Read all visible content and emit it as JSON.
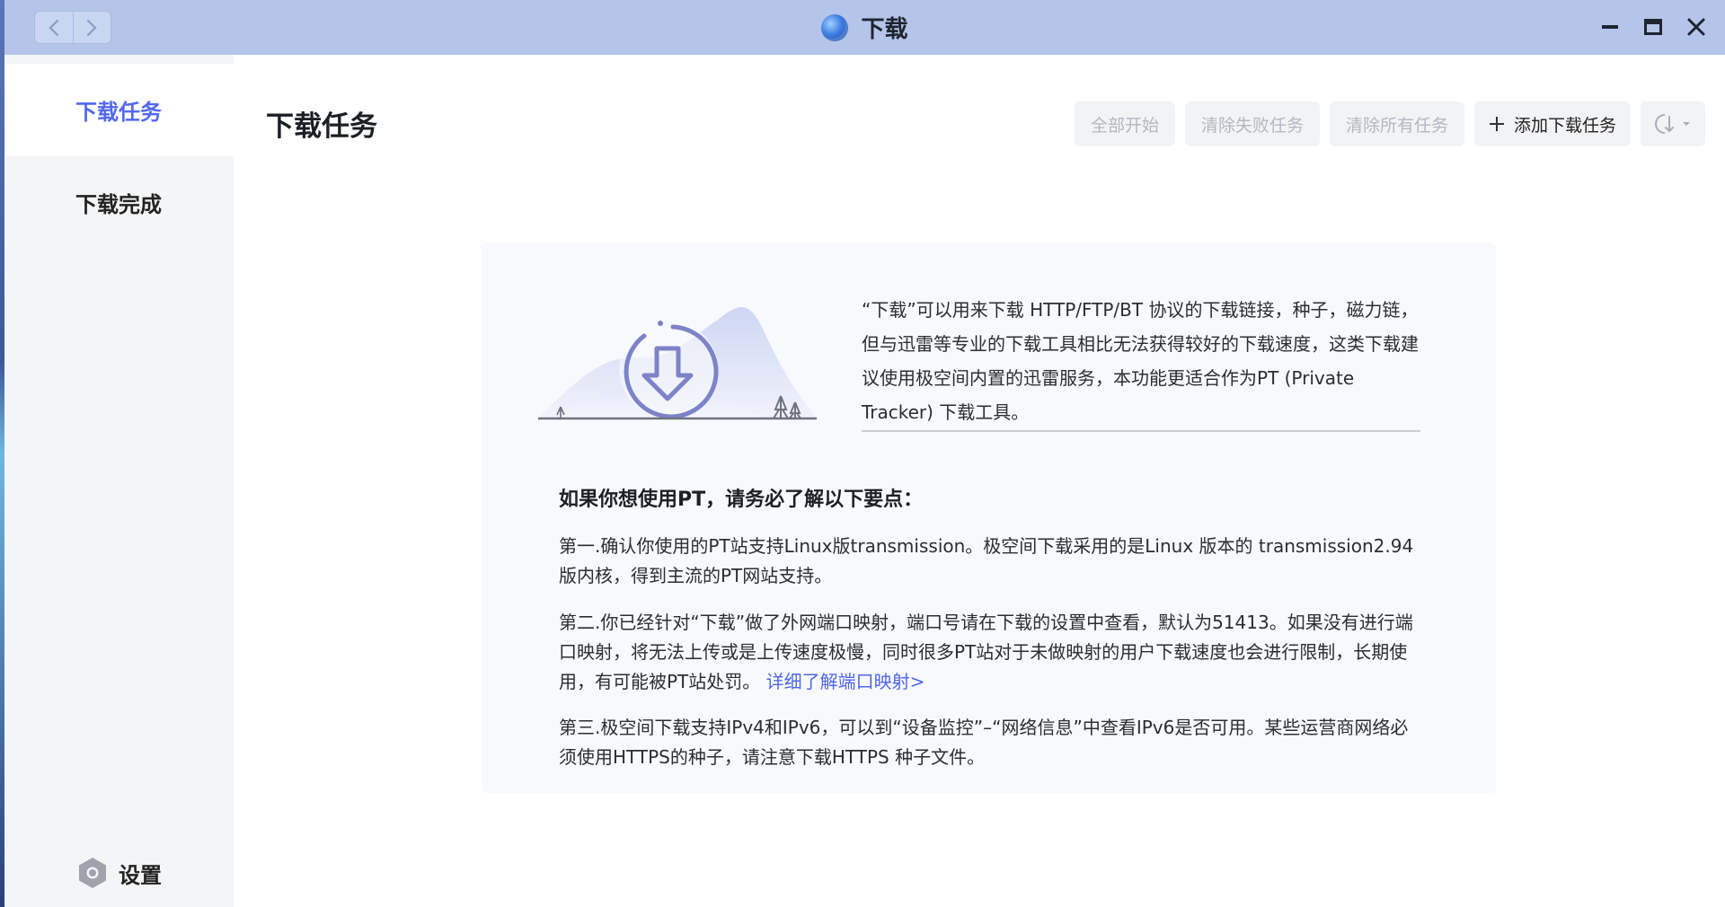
{
  "window": {
    "title": "下载",
    "back_glyph": "‹",
    "forward_glyph": "›"
  },
  "sidebar": {
    "items": [
      {
        "label": "下载任务",
        "active": true
      },
      {
        "label": "下载完成",
        "active": false
      }
    ],
    "settings_label": "设置"
  },
  "main": {
    "page_title": "下载任务",
    "toolbar": {
      "start_all": "全部开始",
      "clear_failed": "清除失败任务",
      "clear_all": "清除所有任务",
      "add_task": "添加下载任务",
      "add_icon": "plus-icon",
      "sort_icon": "sort-icon"
    }
  },
  "info": {
    "intro": "“下载”可以用来下载 HTTP/FTP/BT 协议的下载链接，种子，磁力链，但与迅雷等专业的下载工具相比无法获得较好的下载速度，这类下载建议使用极空间内置的迅雷服务，本功能更适合作为PT (Private Tracker) 下载工具。",
    "tips_heading": "如果你想使用PT，请务必了解以下要点：",
    "tip1": "第一.确认你使用的PT站支持Linux版transmission。极空间下载采用的是Linux 版本的 transmission2.94版内核，得到主流的PT网站支持。",
    "tip2": "第二.你已经针对“下载”做了外网端口映射，端口号请在下载的设置中查看，默认为51413。如果没有进行端口映射，将无法上传或是上传速度极慢，同时很多PT站对于未做映射的用户下载速度也会进行限制，长期使用，有可能被PT站处罚。",
    "tip2_link": "详细了解端口映射>",
    "tip3": "第三.极空间下载支持IPv4和IPv6，可以到“设备监控”–“网络信息”中查看IPv6是否可用。某些运营商网络必须使用HTTPS的种子，请注意下载HTTPS 种子文件。"
  },
  "colors": {
    "accent": "#5268f0",
    "link": "#4f66e8",
    "titlebar": "#b4c5e9"
  }
}
